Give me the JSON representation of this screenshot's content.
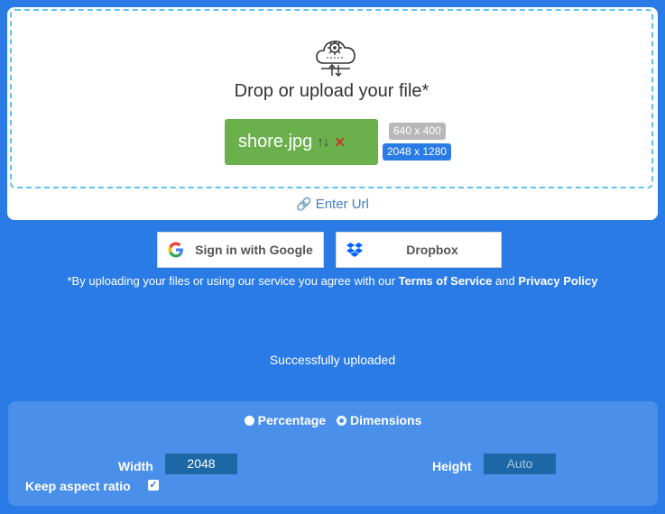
{
  "upload": {
    "prompt": "Drop or upload your file*",
    "file_name": "shore.jpg",
    "dim_original": "640 x 400",
    "dim_resized": "2048 x 1280",
    "enter_url": "Enter Url"
  },
  "auth": {
    "google_label": "Sign in with Google",
    "dropbox_label": "Dropbox"
  },
  "terms": {
    "prefix": "*By uploading your files or using our service you agree with our ",
    "tos": "Terms of Service",
    "and": " and ",
    "privacy": "Privacy Policy"
  },
  "status": "Successfully uploaded",
  "settings": {
    "mode_percentage": "Percentage",
    "mode_dimensions": "Dimensions",
    "selected_mode": "Dimensions",
    "width_label": "Width",
    "width_value": "2048",
    "height_label": "Height",
    "height_placeholder": "Auto",
    "keep_aspect_label": "Keep aspect ratio",
    "keep_aspect_checked": true
  },
  "colors": {
    "background": "#2a7be6",
    "file_chip": "#6ab04c",
    "dropzone_border": "#5cc3f0"
  }
}
